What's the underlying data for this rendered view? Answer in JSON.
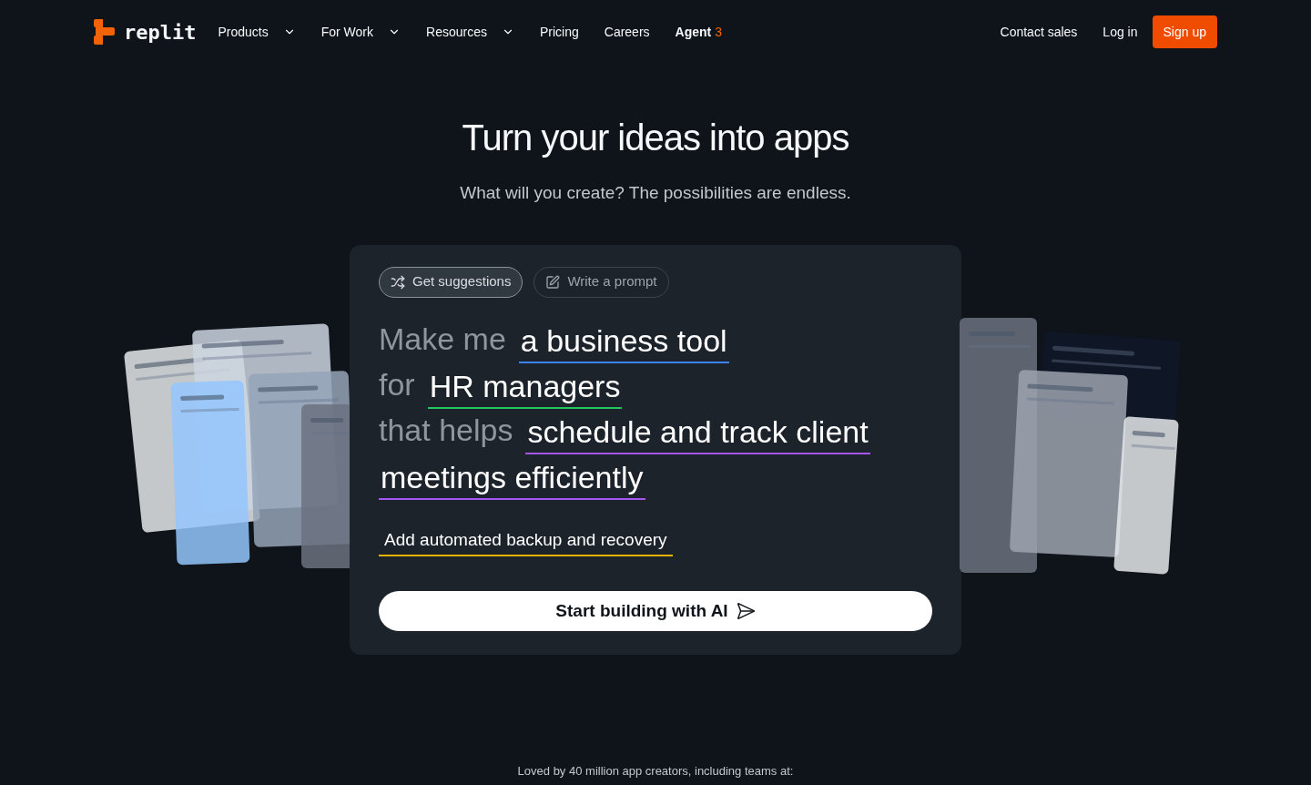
{
  "nav": {
    "logo": "replit",
    "items": [
      {
        "label": "Products",
        "dropdown": true
      },
      {
        "label": "For Work",
        "dropdown": true
      },
      {
        "label": "Resources",
        "dropdown": true
      },
      {
        "label": "Pricing",
        "dropdown": false
      },
      {
        "label": "Careers",
        "dropdown": false
      }
    ],
    "agent": {
      "label": "Agent",
      "badge": "3"
    },
    "actions": [
      {
        "label": "Contact sales",
        "kind": "link"
      },
      {
        "label": "Log in",
        "kind": "link"
      },
      {
        "label": "Sign up",
        "kind": "primary"
      }
    ]
  },
  "hero": {
    "title": "Turn your ideas into apps",
    "subtitle": "What will you create? The possibilities are endless."
  },
  "prompt_card": {
    "modes": [
      {
        "label": "Get suggestions",
        "kind": "shuffle",
        "selected": true
      },
      {
        "label": "Write a prompt",
        "kind": "edit",
        "selected": false
      }
    ],
    "lines": [
      [
        {
          "text": "Make me",
          "kind": "fixed"
        },
        {
          "text": "a business tool",
          "kind": "choice",
          "color": "#3b82f6"
        }
      ],
      [
        {
          "text": "for",
          "kind": "fixed"
        },
        {
          "text": "HR managers",
          "kind": "choice",
          "color": "#22c55e"
        }
      ],
      [
        {
          "text": "that helps",
          "kind": "fixed"
        },
        {
          "text": "schedule and track client",
          "kind": "choice",
          "color": "#a855f7"
        }
      ],
      [
        {
          "text": "meetings efficiently",
          "kind": "choice",
          "color": "#a855f7"
        }
      ]
    ],
    "extra": {
      "text": "Add automated backup and recovery",
      "color": "#eab308"
    },
    "cta": "Start building with AI"
  },
  "footer_note": "Loved by 40 million app creators, including teams at:"
}
